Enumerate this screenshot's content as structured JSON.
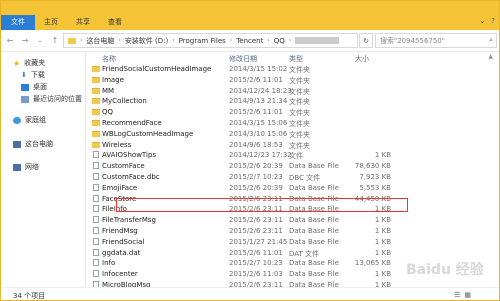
{
  "ribbon": {
    "file_tab": "文件",
    "tabs": [
      "主页",
      "共享",
      "查看"
    ]
  },
  "address": {
    "crumbs": [
      "这台电脑",
      "安装软件 (D:)",
      "Program Files",
      "Tencent",
      "QQ"
    ],
    "search_placeholder": "搜索\"2094556750\""
  },
  "sidebar": {
    "items": [
      {
        "label": "收藏夹",
        "icon": "star-icon"
      },
      {
        "label": "下载",
        "icon": "download-icon"
      },
      {
        "label": "桌面",
        "icon": "desktop-icon"
      },
      {
        "label": "最近访问的位置",
        "icon": "recent-icon"
      },
      {
        "label": "家庭组",
        "icon": "homegroup-icon"
      },
      {
        "label": "这台电脑",
        "icon": "computer-icon"
      },
      {
        "label": "网络",
        "icon": "network-icon"
      }
    ]
  },
  "list": {
    "headers": {
      "name": "名称",
      "date": "修改日期",
      "type": "类型",
      "size": "大小"
    },
    "rows": [
      {
        "name": "FriendSocialCustomHeadImage",
        "date": "2014/3/15 15:02",
        "type": "文件夹",
        "size": "",
        "kind": "folder"
      },
      {
        "name": "Image",
        "date": "2015/2/6 11:01",
        "type": "文件夹",
        "size": "",
        "kind": "folder"
      },
      {
        "name": "MM",
        "date": "2014/12/24 18:23",
        "type": "文件夹",
        "size": "",
        "kind": "folder"
      },
      {
        "name": "MyCollection",
        "date": "2014/9/13 21:34",
        "type": "文件夹",
        "size": "",
        "kind": "folder"
      },
      {
        "name": "QQ",
        "date": "2015/2/6 11:01",
        "type": "文件夹",
        "size": "",
        "kind": "folder"
      },
      {
        "name": "RecommendFace",
        "date": "2014/3/15 15:06",
        "type": "文件夹",
        "size": "",
        "kind": "folder"
      },
      {
        "name": "WBLogCustomHeadImage",
        "date": "2014/3/10 15:06",
        "type": "文件夹",
        "size": "",
        "kind": "folder"
      },
      {
        "name": "Wireless",
        "date": "2014/9/6 18:53",
        "type": "文件夹",
        "size": "",
        "kind": "folder"
      },
      {
        "name": "AVAIOShowTips",
        "date": "2014/12/23 17:32",
        "type": "文件",
        "size": "1 KB",
        "kind": "file"
      },
      {
        "name": "CustomFace",
        "date": "2015/2/6 20:39",
        "type": "Data Base File",
        "size": "78,630 KB",
        "kind": "db"
      },
      {
        "name": "CustomFace.dbc",
        "date": "2015/2/7 10:23",
        "type": "DBC 文件",
        "size": "7,923 KB",
        "kind": "file"
      },
      {
        "name": "EmojiFace",
        "date": "2015/2/6 20:39",
        "type": "Data Base File",
        "size": "5,553 KB",
        "kind": "db"
      },
      {
        "name": "FaceStore",
        "date": "2015/2/6 23:11",
        "type": "Data Base File",
        "size": "44,450 KB",
        "kind": "db"
      },
      {
        "name": "FileInfo",
        "date": "2015/2/6 23:11",
        "type": "Data Base File",
        "size": "1 KB",
        "kind": "db"
      },
      {
        "name": "FileTransferMsg",
        "date": "2015/2/6 23:11",
        "type": "Data Base File",
        "size": "1 KB",
        "kind": "db"
      },
      {
        "name": "FriendMsg",
        "date": "2015/2/6 23:11",
        "type": "Data Base File",
        "size": "1 KB",
        "kind": "db"
      },
      {
        "name": "FriendSocial",
        "date": "2015/1/27 21:45",
        "type": "Data Base File",
        "size": "1 KB",
        "kind": "db"
      },
      {
        "name": "ggdata.dat",
        "date": "2015/2/6 11:01",
        "type": "DAT 文件",
        "size": "1 KB",
        "kind": "file"
      },
      {
        "name": "Info",
        "date": "2015/2/7 10:23",
        "type": "Data Base File",
        "size": "13,065 KB",
        "kind": "db"
      },
      {
        "name": "Infocenter",
        "date": "2015/2/6 11:03",
        "type": "Data Base File",
        "size": "1 KB",
        "kind": "db"
      },
      {
        "name": "MicroBlogMsg",
        "date": "2015/2/6 23:11",
        "type": "Data Base File",
        "size": "1 KB",
        "kind": "db"
      }
    ]
  },
  "status": {
    "count": "34 个项目"
  },
  "watermark": "Baidu 经验"
}
